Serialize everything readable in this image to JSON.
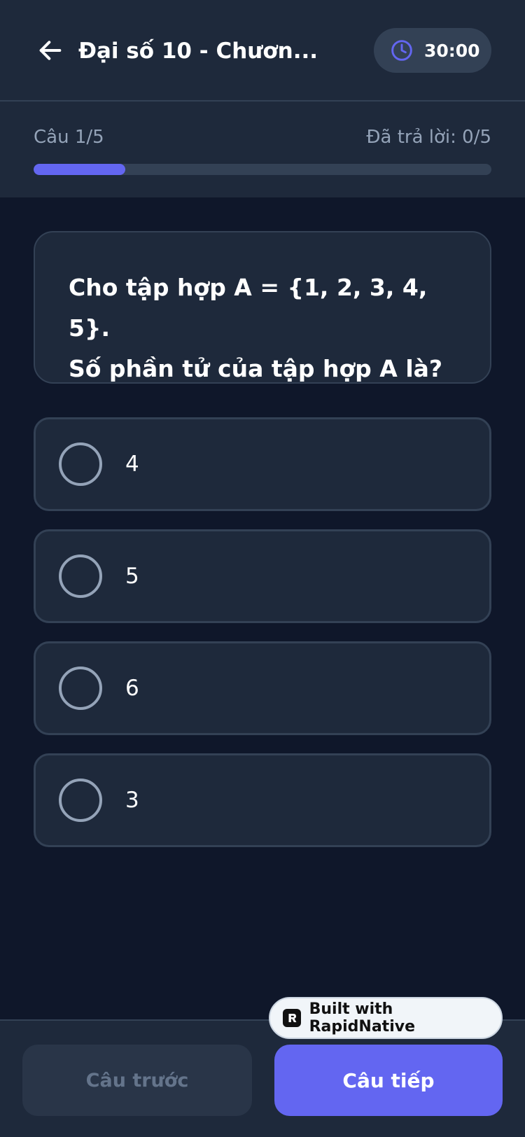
{
  "header": {
    "title": "Đại số 10 - Chươn...",
    "timer": "30:00"
  },
  "progress": {
    "question_label": "Câu 1/5",
    "answered_label": "Đã trả lời: 0/5",
    "fraction": 0.2,
    "accent_color": "#6366f1"
  },
  "question": {
    "line1": "Cho tập hợp A = {1, 2, 3, 4, 5}.",
    "line2": "Số phần tử của tập hợp A là?"
  },
  "options": [
    {
      "label": "4"
    },
    {
      "label": "5"
    },
    {
      "label": "6"
    },
    {
      "label": "3"
    }
  ],
  "footer": {
    "prev_label": "Câu trước",
    "next_label": "Câu tiếp"
  },
  "badge": {
    "text": "Built with RapidNative"
  },
  "icons": {
    "back": "arrow-left-icon",
    "timer": "clock-icon",
    "badge": "rapidnative-logo-icon"
  }
}
